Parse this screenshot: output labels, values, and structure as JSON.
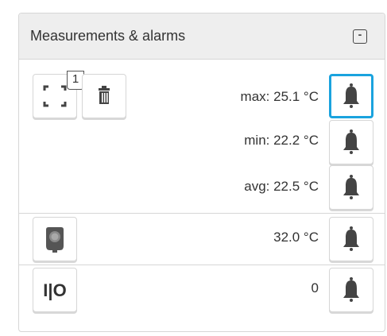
{
  "panel": {
    "title": "Measurements & alarms",
    "collapse_symbol": "-"
  },
  "tools": {
    "selection_icon": "selection-frame-icon",
    "selection_badge": "1",
    "delete_icon": "trash-icon"
  },
  "measurements": [
    {
      "label": "max: 25.1 °C",
      "alarm_icon": "bell-icon",
      "active": true
    },
    {
      "label": "min: 22.2 °C",
      "alarm_icon": "bell-icon",
      "active": false
    },
    {
      "label": "avg: 22.5 °C",
      "alarm_icon": "bell-icon",
      "active": false
    }
  ],
  "sensor": {
    "icon": "sensor-device-icon",
    "value": "32.0 °C",
    "alarm_icon": "bell-icon"
  },
  "digital": {
    "label": "I|O",
    "value": "0",
    "alarm_icon": "bell-icon"
  },
  "colors": {
    "active_border": "#1aa3de",
    "icon_gray": "#444444"
  }
}
